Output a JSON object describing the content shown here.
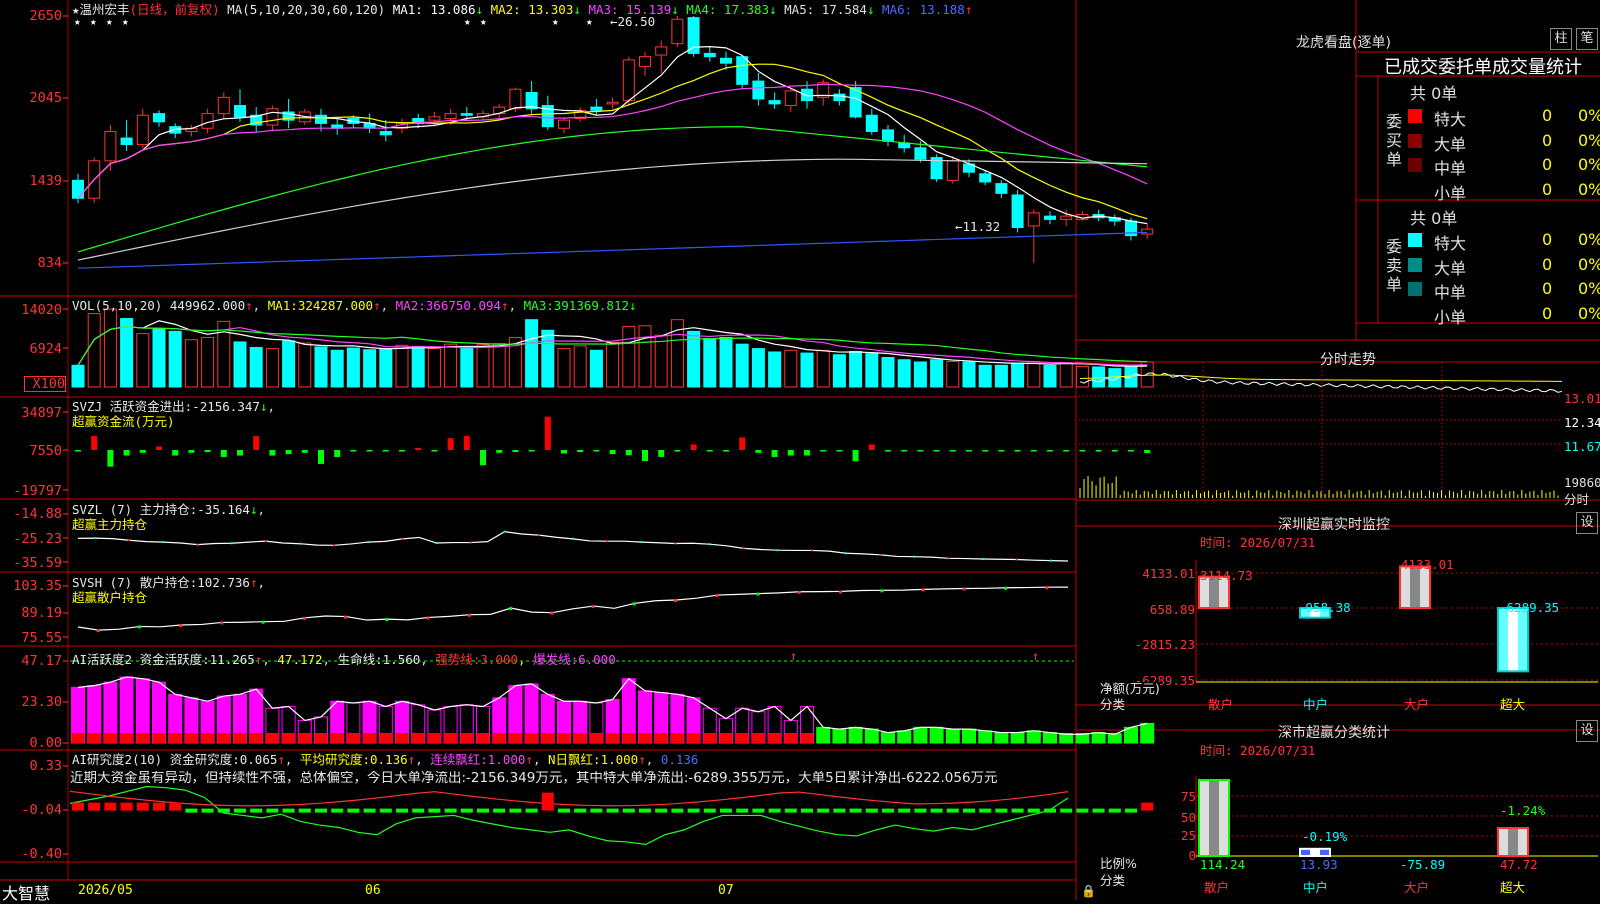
{
  "stock": {
    "star": "★",
    "name": "温州宏丰",
    "mode": "(日线，前复权)",
    "ma_label": "MA(5,10,20,30,60,120)"
  },
  "price_ma": [
    {
      "label": "MA1:",
      "value": "13.086",
      "arrow": "↓",
      "color": "#ffffff"
    },
    {
      "label": "MA2:",
      "value": "13.303",
      "arrow": "↓",
      "color": "#ffff00"
    },
    {
      "label": "MA3:",
      "value": "15.139",
      "arrow": "↓",
      "color": "#ff44ff"
    },
    {
      "label": "MA4:",
      "value": "17.383",
      "arrow": "↓",
      "color": "#22ff22"
    },
    {
      "label": "MA5:",
      "value": "17.584",
      "arrow": "↓",
      "color": "#e0e0e0"
    },
    {
      "label": "MA6:",
      "value": "13.188",
      "arrow": "↑",
      "color": "#4a6cff"
    }
  ],
  "vol_head": {
    "label": "VOL(5,10,20)",
    "value": "449962.000",
    "arrow": "↑",
    "ma1": "324287.000",
    "ma1_arrow": "↑",
    "ma2": "366750.094",
    "ma2_arrow": "↑",
    "ma3": "391369.812",
    "ma3_arrow": "↓"
  },
  "svzj": {
    "label": "SVZJ",
    "name": "活跃资金进出:",
    "value": "-2156.347",
    "arrow": "↓",
    "sub": "超赢资金流(万元)"
  },
  "svzl": {
    "label": "SVZL (7)",
    "name": "主力持仓:",
    "value": "-35.164",
    "arrow": "↓",
    "sub": "超赢主力持仓"
  },
  "svsh": {
    "label": "SVSH (7)",
    "name": "散户持仓:",
    "value": "102.736",
    "arrow": "↑",
    "sub": "超赢散户持仓"
  },
  "ai1": {
    "label": "AI活跃度2",
    "name": "资金活跃度:",
    "value": "11.265",
    "arrow": "↑",
    "v2": "47.172",
    "life_label": "生命线:",
    "life": "1.560",
    "strong_label": "强势线:",
    "strong": "3.000",
    "burst_label": "爆发线:",
    "burst": "6.000"
  },
  "ai2": {
    "label": "AI研究度2(10)",
    "name": "资金研究度:",
    "value": "0.065",
    "arrow": "↑",
    "avg_label": "平均研究度:",
    "avg": "0.136",
    "avg_arrow": "↑",
    "lx_label": "连续飘红:",
    "lx": "1.000",
    "lx_arrow": "↑",
    "n_label": "N日飘红:",
    "n": "1.000",
    "n_arrow": "↑",
    "last": "0.136"
  },
  "commentary": "近期大资金虽有异动，但持续性不强，总体偏空，今日大单净流出:-2156.349万元，其中特大单净流出:-6289.355万元，大单5日累计净出-6222.056万元",
  "axes": {
    "price": [
      "2650",
      "2045",
      "1439",
      "834"
    ],
    "vol": [
      "14020",
      "6924",
      "X100"
    ],
    "svzj": [
      "34897",
      "7550",
      "-19797"
    ],
    "svzl": [
      "-14.88",
      "-25.23",
      "-35.59"
    ],
    "svsh": [
      "103.35",
      "89.19",
      "75.55"
    ],
    "ai1": [
      "47.17",
      "23.30",
      "0.00"
    ],
    "ai2": [
      "0.33",
      "-0.04",
      "-0.40"
    ]
  },
  "annotations": {
    "high": "26.50",
    "low": "11.32"
  },
  "dates": [
    "2026/05",
    "06",
    "07"
  ],
  "brand": "大智慧",
  "chart_data": [
    {
      "type": "candlestick",
      "title": "温州宏丰 (日线，前复权)",
      "ohlc": [
        [
          16.4,
          16.8,
          15.0,
          15.3
        ],
        [
          15.3,
          17.8,
          15.0,
          17.6
        ],
        [
          17.6,
          19.8,
          17.0,
          19.4
        ],
        [
          19.0,
          20.1,
          18.2,
          18.6
        ],
        [
          18.6,
          20.8,
          18.4,
          20.4
        ],
        [
          20.5,
          20.7,
          19.7,
          20.0
        ],
        [
          19.7,
          19.9,
          19.0,
          19.3
        ],
        [
          19.4,
          19.8,
          19.1,
          19.6
        ],
        [
          19.6,
          20.8,
          19.3,
          20.5
        ],
        [
          20.5,
          21.8,
          20.2,
          21.5
        ],
        [
          21.0,
          22.0,
          20.0,
          20.3
        ],
        [
          20.4,
          20.9,
          19.4,
          19.8
        ],
        [
          19.8,
          21.0,
          19.4,
          20.8
        ],
        [
          20.6,
          21.4,
          19.6,
          20.1
        ],
        [
          20.0,
          20.8,
          19.8,
          20.6
        ],
        [
          20.4,
          20.8,
          19.4,
          19.9
        ],
        [
          19.8,
          20.3,
          19.2,
          19.6
        ],
        [
          20.2,
          20.4,
          19.6,
          19.9
        ],
        [
          19.9,
          20.5,
          19.3,
          19.6
        ],
        [
          19.4,
          20.1,
          18.8,
          19.2
        ],
        [
          19.6,
          20.2,
          19.3,
          19.9
        ],
        [
          20.2,
          20.5,
          19.6,
          19.9
        ],
        [
          20.1,
          20.6,
          19.8,
          20.3
        ],
        [
          20.2,
          20.8,
          19.8,
          20.5
        ],
        [
          20.5,
          20.9,
          20.1,
          20.4
        ],
        [
          20.3,
          20.7,
          20.1,
          20.5
        ],
        [
          20.5,
          21.1,
          20.2,
          20.9
        ],
        [
          20.8,
          22.1,
          20.6,
          22.0
        ],
        [
          21.8,
          22.5,
          20.5,
          20.8
        ],
        [
          21.0,
          21.6,
          19.5,
          19.7
        ],
        [
          19.6,
          20.2,
          19.3,
          20.1
        ],
        [
          20.2,
          20.9,
          20.0,
          20.7
        ],
        [
          20.9,
          21.4,
          20.4,
          20.7
        ],
        [
          21.1,
          21.5,
          20.8,
          21.2
        ],
        [
          21.3,
          24.0,
          21.0,
          23.8
        ],
        [
          23.4,
          24.3,
          22.8,
          24.0
        ],
        [
          24.1,
          25.0,
          23.0,
          24.6
        ],
        [
          24.8,
          26.5,
          24.6,
          26.3
        ],
        [
          26.4,
          26.5,
          24.0,
          24.2
        ],
        [
          24.2,
          24.6,
          23.7,
          24.0
        ],
        [
          23.9,
          24.3,
          23.2,
          23.6
        ],
        [
          24.0,
          24.1,
          22.0,
          22.3
        ],
        [
          22.5,
          23.0,
          21.0,
          21.4
        ],
        [
          21.3,
          21.8,
          20.8,
          21.1
        ],
        [
          21.0,
          22.1,
          20.6,
          21.9
        ],
        [
          22.0,
          22.5,
          20.8,
          21.3
        ],
        [
          21.5,
          22.6,
          21.0,
          22.4
        ],
        [
          21.7,
          22.0,
          21.0,
          21.3
        ],
        [
          22.1,
          22.5,
          20.2,
          20.3
        ],
        [
          20.4,
          20.8,
          19.2,
          19.4
        ],
        [
          19.5,
          19.8,
          18.5,
          18.8
        ],
        [
          18.7,
          19.2,
          18.1,
          18.4
        ],
        [
          18.4,
          18.8,
          17.5,
          17.7
        ],
        [
          17.8,
          18.0,
          16.3,
          16.5
        ],
        [
          16.4,
          17.9,
          16.2,
          17.6
        ],
        [
          17.4,
          17.7,
          16.6,
          16.9
        ],
        [
          16.8,
          17.0,
          16.1,
          16.3
        ],
        [
          16.2,
          16.4,
          15.3,
          15.6
        ],
        [
          15.5,
          15.8,
          13.2,
          13.5
        ],
        [
          13.6,
          14.6,
          11.32,
          14.4
        ],
        [
          14.2,
          14.5,
          13.7,
          14.0
        ],
        [
          14.0,
          14.6,
          13.6,
          14.2
        ],
        [
          14.0,
          14.5,
          13.9,
          14.3
        ],
        [
          14.3,
          14.6,
          13.9,
          14.1
        ],
        [
          14.1,
          14.3,
          13.6,
          13.9
        ],
        [
          13.9,
          14.1,
          12.7,
          13.0
        ],
        [
          13.1,
          13.7,
          12.8,
          13.4
        ]
      ],
      "ylim": [
        11.32,
        26.5
      ],
      "y_ticks": [
        "2650",
        "2045",
        "1439",
        "834"
      ],
      "ma": [
        "MA1",
        "MA2",
        "MA3",
        "MA4",
        "MA5",
        "MA6"
      ]
    },
    {
      "type": "bar",
      "title": "VOL(5,10,20)",
      "values": [
        3.9,
        13.2,
        14.0,
        12.3,
        9.6,
        10.4,
        10.0,
        8.5,
        8.9,
        11.8,
        8.1,
        7.1,
        6.9,
        8.3,
        7.9,
        7.2,
        6.6,
        7.0,
        6.7,
        6.9,
        7.5,
        7.3,
        6.9,
        7.7,
        7.0,
        7.6,
        7.8,
        8.9,
        12.1,
        10.2,
        6.9,
        7.4,
        6.6,
        8.0,
        10.9,
        11.0,
        9.3,
        12.1,
        10.0,
        8.7,
        8.9,
        7.7,
        6.9,
        6.3,
        6.6,
        6.1,
        6.6,
        5.8,
        6.4,
        6.0,
        5.3,
        4.9,
        4.5,
        4.9,
        4.6,
        4.5,
        3.9,
        3.9,
        4.3,
        4.6,
        3.9,
        4.4,
        3.7,
        3.6,
        3.3,
        3.7,
        4.5
      ],
      "unit": "X100",
      "ylim": [
        0,
        14020
      ]
    },
    {
      "type": "bar",
      "title": "SVZJ 活跃资金进出",
      "values": [
        -500,
        10000,
        -12000,
        -4000,
        -2000,
        2500,
        -4000,
        -2000,
        -1500,
        -5000,
        -4000,
        10000,
        -4000,
        -3000,
        -2000,
        -10000,
        -5000,
        -800,
        -800,
        -700,
        -800,
        1500,
        -400,
        8500,
        10000,
        -11000,
        -2000,
        -1500,
        -1000,
        24000,
        -2500,
        -1500,
        -1000,
        -3000,
        -3800,
        -8000,
        -5000,
        -800,
        4000,
        -600,
        -800,
        9000,
        -2000,
        -5000,
        -4000,
        -4000,
        -500,
        -1000,
        -8000,
        4000,
        -800,
        -600,
        -700,
        -900,
        -800,
        -700,
        -600,
        -500,
        -500,
        -1000,
        -500,
        -800,
        -800,
        -500,
        -500,
        -800,
        -2156.347
      ],
      "ylim": [
        -19797,
        34897
      ],
      "y_ticks": [
        "34897",
        "7550",
        "-19797"
      ]
    },
    {
      "type": "line",
      "title": "SVZL (7) 主力持仓",
      "y": [
        -25.4,
        -25.3,
        -25.5,
        -26.2,
        -26.8,
        -27.0,
        -27.4,
        -28.1,
        -27.6,
        -27.5,
        -27.0,
        -26.6,
        -27.4,
        -27.7,
        -28.3,
        -28.4,
        -27.8,
        -27.0,
        -26.7,
        -25.6,
        -25.0,
        -27.4,
        -27.2,
        -27.2,
        -26.8,
        -22.5,
        -23.5,
        -24.0,
        -24.9,
        -25.6,
        -26.5,
        -26.6,
        -26.6,
        -27.0,
        -27.3,
        -27.6,
        -27.5,
        -27.9,
        -28.6,
        -29.7,
        -30.2,
        -30.5,
        -30.6,
        -30.6,
        -30.9,
        -31.8,
        -32.1,
        -32.5,
        -33.2,
        -33.3,
        -33.5,
        -34.0,
        -34.1,
        -34.3,
        -34.4,
        -34.5,
        -34.8,
        -35.0,
        -35.164
      ],
      "ylim": [
        -35.59,
        -14.88
      ]
    },
    {
      "type": "line",
      "title": "SVSH (7) 散户持仓",
      "y": [
        81.0,
        79.3,
        79.8,
        81.3,
        81.1,
        82.1,
        82.4,
        83.5,
        83.6,
        83.9,
        84.1,
        86.0,
        87.0,
        86.7,
        84.8,
        85.3,
        84.9,
        86.2,
        86.8,
        87.7,
        87.9,
        91.3,
        89.1,
        88.8,
        90.9,
        92.4,
        91.2,
        93.9,
        95.3,
        95.7,
        96.7,
        98.4,
        98.8,
        99.2,
        99.6,
        100.2,
        100.3,
        100.4,
        100.9,
        101.0,
        101.1,
        101.5,
        101.8,
        102.0,
        102.1,
        102.4,
        102.5,
        102.7,
        102.736
      ],
      "ylim": [
        75.55,
        103.35
      ]
    },
    {
      "type": "bar",
      "title": "AI活跃度2 资金活跃度",
      "values": [
        32,
        33,
        35,
        38,
        37,
        35,
        28,
        26,
        24,
        27,
        28,
        31,
        20,
        21,
        13,
        15,
        24,
        23,
        24,
        21,
        24,
        22,
        19,
        21,
        22,
        21,
        26,
        33,
        34,
        28,
        24,
        24,
        23,
        25,
        37,
        30,
        29,
        28,
        26,
        20,
        14,
        20,
        18,
        21,
        13,
        21,
        9,
        8,
        9,
        8,
        6,
        7,
        9,
        9,
        8,
        8,
        7,
        6,
        6,
        7,
        6,
        5,
        5,
        6,
        5,
        9,
        11.265
      ],
      "ylim": [
        0,
        47.17
      ],
      "y_ticks": [
        "47.17",
        "23.30",
        "0.00"
      ]
    },
    {
      "type": "line",
      "title": "AI研究度2(10) 资金研究度",
      "y": [
        0.02,
        0.05,
        0.08,
        0.12,
        0.16,
        0.15,
        0.13,
        0.07,
        -0.06,
        -0.08,
        -0.1,
        -0.07,
        -0.13,
        -0.16,
        -0.18,
        -0.22,
        -0.24,
        -0.15,
        -0.1,
        -0.09,
        -0.08,
        -0.12,
        -0.15,
        -0.18,
        -0.2,
        -0.22,
        -0.2,
        -0.25,
        -0.29,
        -0.3,
        -0.32,
        -0.24,
        -0.2,
        -0.13,
        -0.08,
        -0.08,
        -0.08,
        -0.13,
        -0.17,
        -0.21,
        -0.24,
        -0.25,
        -0.2,
        -0.16,
        -0.19,
        -0.21,
        -0.18,
        -0.2,
        -0.16,
        -0.12,
        -0.08,
        -0.04,
        0.065
      ],
      "ylim": [
        -0.4,
        0.33
      ],
      "y_ticks": [
        "0.33",
        "-0.04",
        "-0.40"
      ]
    },
    {
      "type": "bar",
      "title": "深圳超赢实时监控",
      "categories": [
        "散户",
        "中户",
        "大户",
        "超大"
      ],
      "values": [
        3114.73,
        -958.38,
        4133.01,
        -6289.35
      ],
      "ylim": [
        -6289.35,
        4133.01
      ],
      "y_ticks": [
        "4133.01",
        "658.89",
        "-2815.23",
        "-6289.35"
      ]
    },
    {
      "type": "bar",
      "title": "深市超赢分类统计",
      "categories": [
        "散户",
        "中户",
        "大户",
        "超大"
      ],
      "values": [
        114.24,
        13.93,
        -75.89,
        47.72
      ],
      "labels": [
        "",
        "-0.19%",
        "",
        "-1.24%"
      ],
      "y_ticks": [
        "75",
        "50",
        "25",
        "0"
      ]
    }
  ],
  "right": {
    "lhb_title": "龙虎看盘(逐单)",
    "btn1": "柱",
    "btn2": "笔",
    "header": "已成交委托单成交量统计",
    "buy_total": "共 0单",
    "sell_total": "共 0单",
    "buy_label": "委买单",
    "sell_label": "委卖单",
    "rows": [
      {
        "name": "特大",
        "count": "0",
        "pct": "0%"
      },
      {
        "name": "大单",
        "count": "0",
        "pct": "0%"
      },
      {
        "name": "中单",
        "count": "0",
        "pct": "0%"
      },
      {
        "name": "小单",
        "count": "0",
        "pct": "0%"
      }
    ],
    "buy_colors": [
      "#ff0000",
      "#8b0000",
      "#6a0000",
      "#000000"
    ],
    "sell_colors": [
      "#00ffff",
      "#008b8b",
      "#007070",
      "#000000"
    ],
    "fs_title": "分时走势",
    "fs_axis": [
      "13.01",
      "12.34",
      "11.67",
      "19860",
      "分时"
    ],
    "mon_title": "深圳超赢实时监控",
    "mon_time": "时间: 2026/07/31",
    "mon_axis": [
      "4133.01",
      "658.89",
      "-2815.23",
      "-6289.35"
    ],
    "mon_unit": "净额(万元)",
    "mon_cat_label": "分类",
    "mon_values": [
      "3114.73",
      "-958.38",
      "4133.01",
      "-6289.35"
    ],
    "stat_title": "深市超赢分类统计",
    "stat_time": "时间: 2026/07/31",
    "stat_axis": [
      "75",
      "50",
      "25",
      "0"
    ],
    "stat_unit": "比例%",
    "stat_cat_label": "分类",
    "stat_pct": [
      "-0.19%",
      "-1.24%"
    ],
    "stat_values": [
      "114.24",
      "13.93",
      "-75.89",
      "47.72"
    ],
    "categories": [
      "散户",
      "中户",
      "大户",
      "超大"
    ],
    "set_label": "设"
  }
}
